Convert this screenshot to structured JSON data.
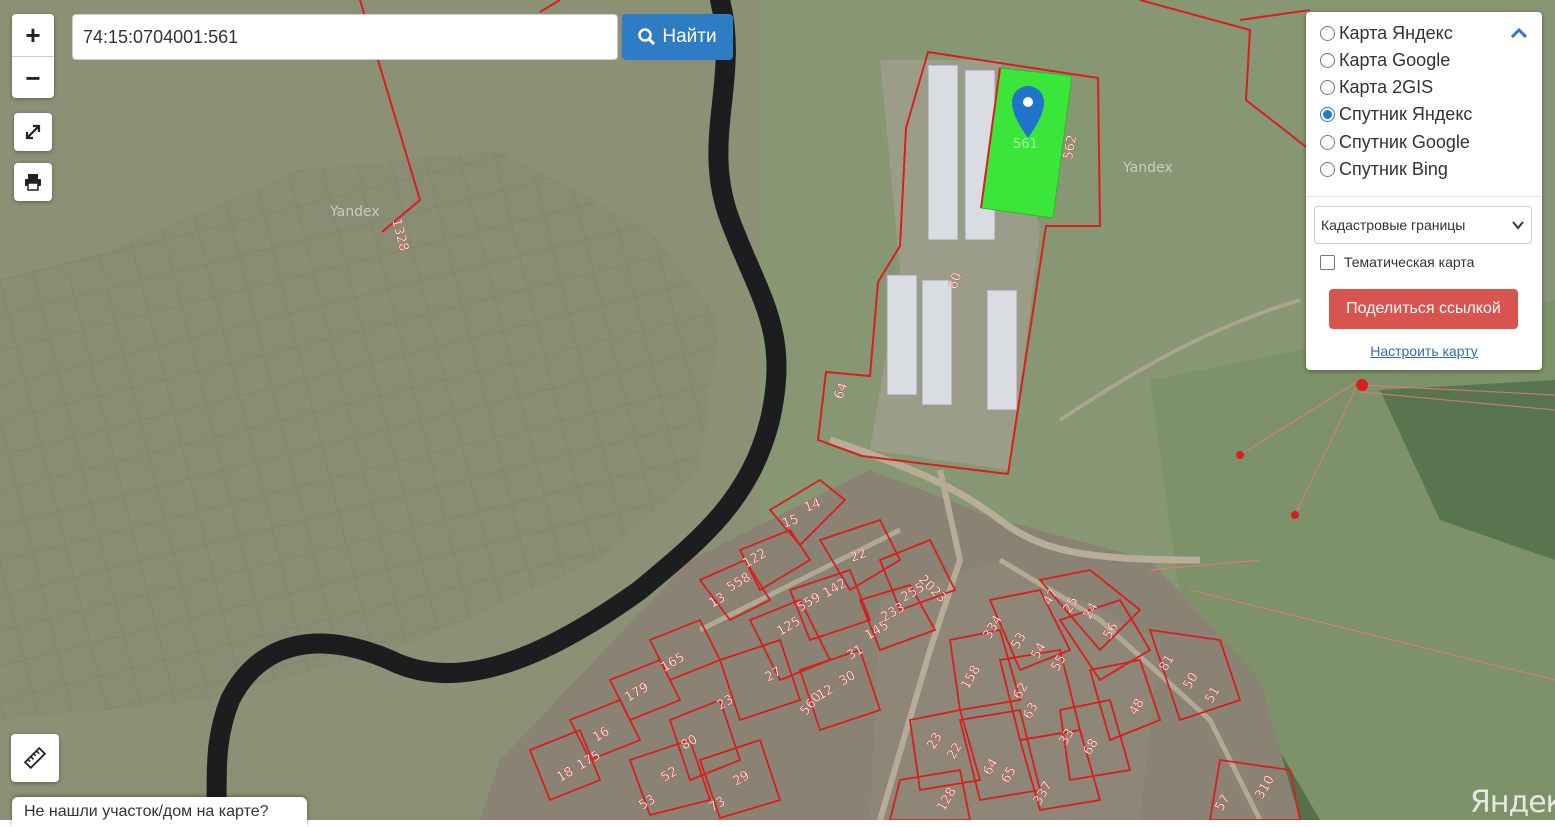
{
  "search": {
    "value": "74:15:0704001:561",
    "button_label": "Найти"
  },
  "layer_panel": {
    "options": [
      {
        "label": "Карта Яндекс",
        "selected": false
      },
      {
        "label": "Карта Google",
        "selected": false
      },
      {
        "label": "Карта 2GIS",
        "selected": false
      },
      {
        "label": "Спутник Яндекс",
        "selected": true
      },
      {
        "label": "Спутник Google",
        "selected": false
      },
      {
        "label": "Спутник Bing",
        "selected": false
      }
    ],
    "overlay_select": "Кадастровые границы",
    "thematic_label": "Тематическая карта",
    "thematic_checked": false,
    "share_label": "Поделиться ссылкой",
    "configure_label": "Настроить карту"
  },
  "help_text": "Не нашли участок/дом на карте?",
  "map": {
    "watermark_tiles": [
      "Yandex",
      "Yandex"
    ],
    "provider_logo": "Яндекс",
    "highlighted_parcel": "561",
    "parcel_labels": [
      "562",
      "60",
      "64",
      "1328",
      "14",
      "15",
      "22",
      "2023",
      "122",
      "558",
      "142",
      "559",
      "255",
      "233",
      "13",
      "125",
      "145",
      "165",
      "31",
      "30",
      "27",
      "12",
      "560",
      "179",
      "23",
      "16",
      "175",
      "80",
      "18",
      "52",
      "29",
      "53",
      "73",
      "47",
      "25",
      "24",
      "56",
      "334",
      "53",
      "54",
      "55",
      "158",
      "62",
      "63",
      "48",
      "81",
      "50",
      "51",
      "23",
      "22",
      "64",
      "65",
      "337",
      "128",
      "33",
      "68",
      "310",
      "57"
    ],
    "colors": {
      "boundary": "#d81f1f",
      "highlight_fill": "#39e639",
      "marker": "#1f73c9",
      "river": "#1b1d1f"
    }
  }
}
